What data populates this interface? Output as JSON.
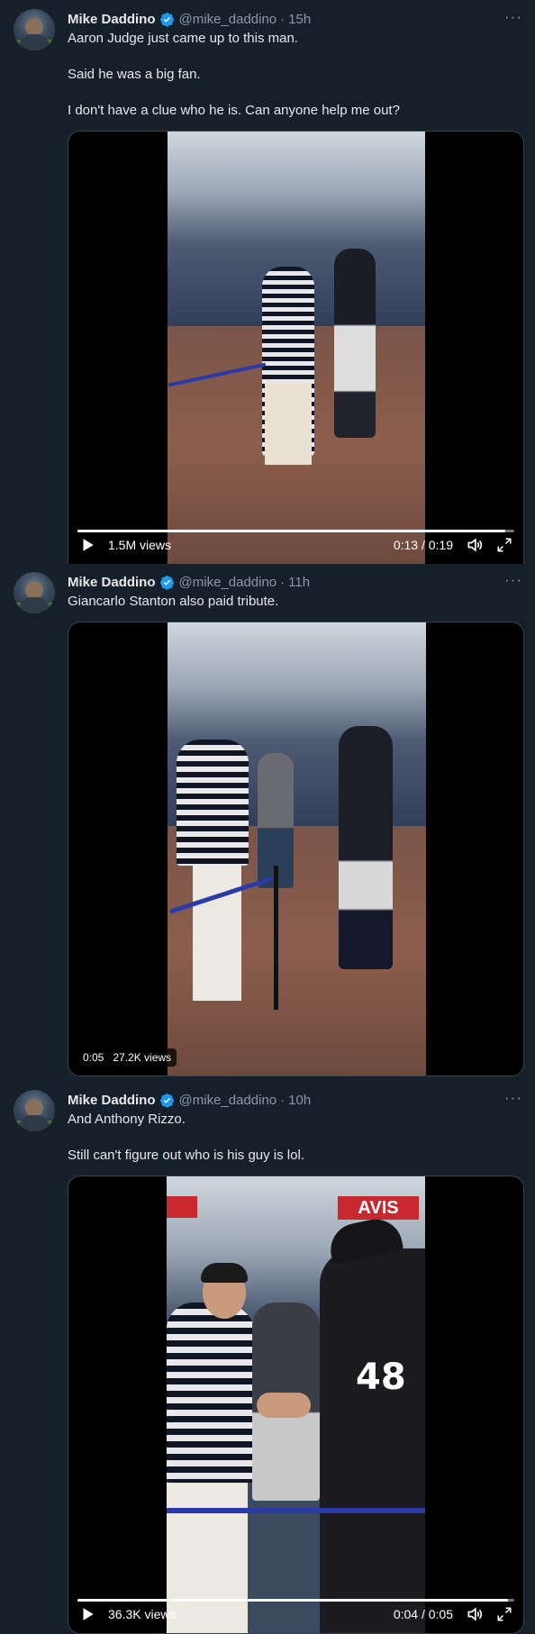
{
  "colors": {
    "background": "#15202b",
    "verified": "#1d9bf0",
    "secondary_text": "#8b98a5"
  },
  "tweets": [
    {
      "name": "Mike Daddino",
      "handle": "@mike_daddino",
      "dot": "·",
      "time": "15h",
      "more": "···",
      "lines": [
        "Aaron Judge just came up to this man.",
        "",
        "Said he was a big fan.",
        "",
        "I don't have a clue who he is. Can anyone help me out?"
      ],
      "video": {
        "views": "1.5M views",
        "time": "0:13 / 0:19",
        "progress": 0.98
      }
    },
    {
      "name": "Mike Daddino",
      "handle": "@mike_daddino",
      "dot": "·",
      "time": "11h",
      "more": "···",
      "lines": [
        "Giancarlo Stanton also paid tribute."
      ],
      "video": {
        "elapsed": "0:05",
        "views": "27.2K views"
      }
    },
    {
      "name": "Mike Daddino",
      "handle": "@mike_daddino",
      "dot": "·",
      "time": "10h",
      "more": "···",
      "lines": [
        "And Anthony Rizzo.",
        "",
        "Still can't figure out who is his guy is lol."
      ],
      "video": {
        "views": "36.3K views",
        "time": "0:04 / 0:05",
        "progress": 0.985,
        "sign": "AVIS",
        "jersey": "48"
      }
    }
  ]
}
